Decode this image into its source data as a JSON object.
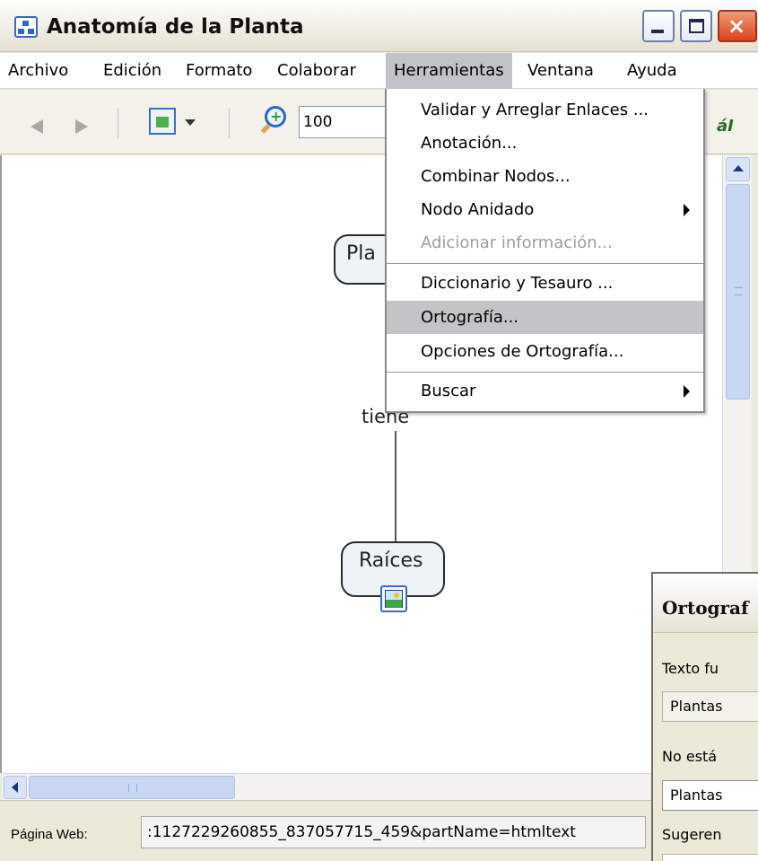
{
  "window": {
    "title": "Anatomía de la Planta",
    "close_glyph": "×"
  },
  "menubar": {
    "items": [
      "Archivo",
      "Edición",
      "Formato",
      "Colaborar",
      "Herramientas",
      "Ventana",
      "Ayuda"
    ],
    "active": "Herramientas"
  },
  "toolbar": {
    "zoom_value": "100",
    "style_icon_glyph": "áI"
  },
  "herramientas_menu": {
    "items": [
      {
        "label": "Validar y Arreglar Enlaces ...",
        "state": "enabled"
      },
      {
        "label": "Anotación...",
        "state": "enabled"
      },
      {
        "label": "Combinar Nodos...",
        "state": "enabled"
      },
      {
        "label": "Nodo Anidado",
        "state": "enabled",
        "submenu": true
      },
      {
        "label": "Adicionar información...",
        "state": "disabled"
      },
      {
        "label": "Diccionario y Tesauro ...",
        "state": "enabled"
      },
      {
        "label": "Ortografía...",
        "state": "highlighted"
      },
      {
        "label": "Opciones de Ortografía...",
        "state": "enabled"
      },
      {
        "label": "Buscar",
        "state": "enabled",
        "submenu": true
      }
    ]
  },
  "concept_map": {
    "nodes": {
      "top": "Pla",
      "bottom": "Raíces"
    },
    "link_label": "tiene"
  },
  "statusbar": {
    "label": "Página Web:",
    "url_value": ":1127229260855_837057715_459&partName=htmltext"
  },
  "spell_dialog": {
    "title": "Ortograf",
    "found_label": "Texto fu",
    "found_value": "Plantas",
    "not_found_label": "No está",
    "input_value": "Plantas",
    "suggestions_label": "Sugeren"
  },
  "colors": {
    "menu_highlight": "#c4c4c6",
    "node_fill": "#eef3f7",
    "close_button": "#d9431c"
  }
}
